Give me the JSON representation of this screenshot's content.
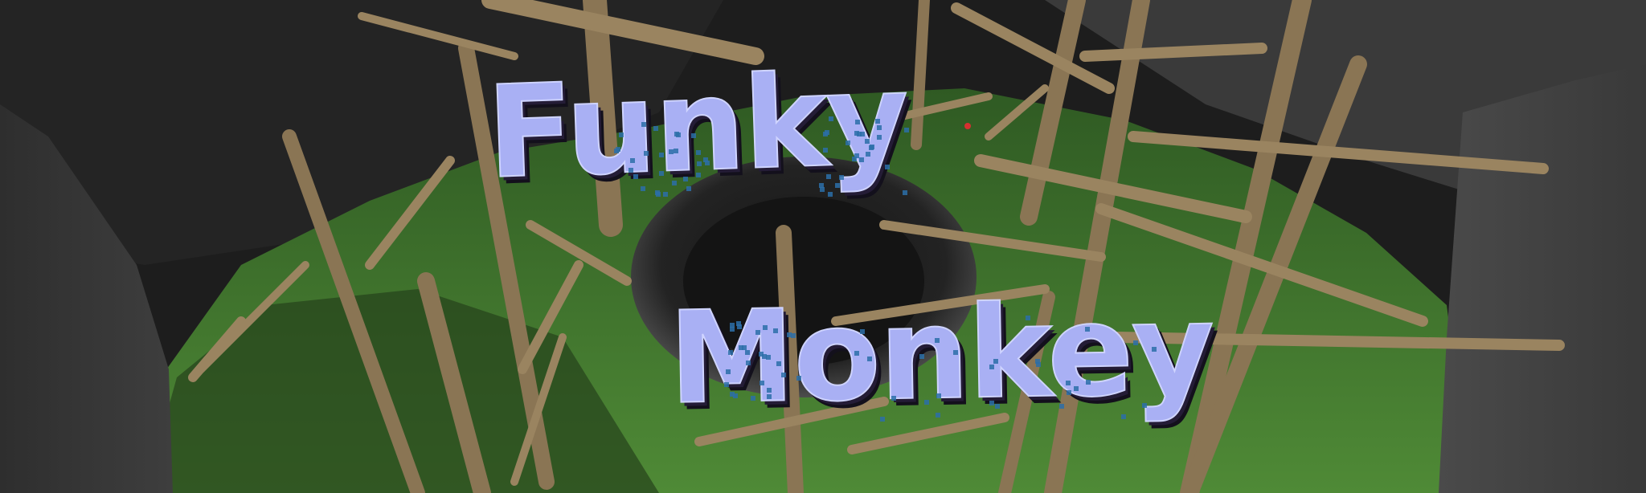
{
  "title": {
    "line1": "Funky",
    "line2": "Monkey"
  },
  "colors": {
    "title_fill": "#a9b0f4",
    "title_shadow": "#241c36",
    "title_speckle": "#2c6fa8",
    "grass": "#3d6b2d",
    "rock": "#3a3a3a",
    "branch": "#8a7554",
    "marker": "#d63030"
  }
}
